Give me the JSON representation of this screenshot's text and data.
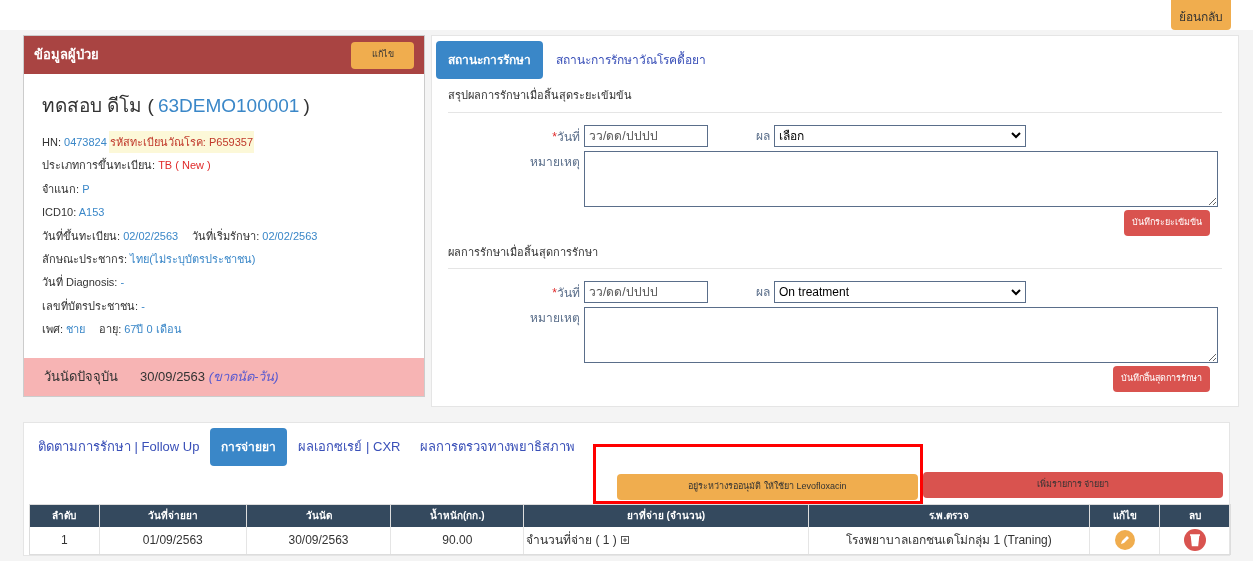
{
  "back_button": "ย้อนกลับ",
  "patient_card": {
    "title": "ข้อมูลผู้ป่วย",
    "edit_button": "แก้ไข",
    "name": "ทดสอบ ดีโม (",
    "code": "63DEMO100001",
    "name_end": ")",
    "lines": [
      [
        {
          "label": "HN:",
          "value": "0473824",
          "kind": "info"
        },
        {
          "label": "รหัสทะเบียนวัณโรค:",
          "value": "P659357",
          "kind": "highlight"
        }
      ],
      [
        {
          "label": "ประเภทการขึ้นทะเบียน:",
          "value": "TB ( New )",
          "kind": "alert"
        }
      ],
      [
        {
          "label": "จำแนก:",
          "value": "P",
          "kind": "info"
        }
      ],
      [
        {
          "label": "ICD10:",
          "value": "A153",
          "kind": "info"
        }
      ],
      [
        {
          "label": "วันที่ขึ้นทะเบียน:",
          "value": "02/02/2563",
          "kind": "info"
        },
        {
          "label": "วันที่เริ่มรักษา:",
          "value": "02/02/2563",
          "kind": "info"
        }
      ],
      [
        {
          "label": "ลักษณะประชากร:",
          "value": "ไทย(ไม่ระบุบัตรประชาชน)",
          "kind": "info"
        }
      ],
      [
        {
          "label": "วันที่ Diagnosis:",
          "value": "-",
          "kind": "info"
        }
      ],
      [
        {
          "label": "เลขที่บัตรประชาชน:",
          "value": "-",
          "kind": "info"
        }
      ],
      [
        {
          "label": "เพศ:",
          "value": "ชาย",
          "kind": "info"
        },
        {
          "label": "อายุ:",
          "value": "67ปี 0 เดือน",
          "kind": "info"
        }
      ]
    ],
    "appointment": {
      "label": "วันนัดปัจจุบัน",
      "date": "30/09/2563",
      "note": "(ขาดนัด-วัน)"
    }
  },
  "status_panel": {
    "tabs": [
      {
        "label": "สถานะการรักษา",
        "selected": true
      },
      {
        "label": "สถานะการรักษาวัณโรคดื้อยา",
        "selected": false
      }
    ],
    "sections": [
      {
        "title": "สรุปผลการรักษาเมื่อสิ้นสุดระยะเข้มข้น",
        "required_mark": "*",
        "date_label": "วันที่",
        "date_placeholder": "วว/ดด/ปปปป",
        "result_label": "ผล",
        "result_value": "เลือก",
        "note_label": "หมายเหตุ",
        "save_button": "บันทึกระยะเข้มข้น"
      },
      {
        "title": "ผลการรักษาเมื่อสิ้นสุดการรักษา",
        "required_mark": "*",
        "date_label": "วันที่",
        "date_placeholder": "วว/ดด/ปปปป",
        "result_label": "ผล",
        "result_value": "On treatment",
        "note_label": "หมายเหตุ",
        "save_button": "บันทึกสิ้นสุดการรักษา"
      }
    ]
  },
  "bottom_panel": {
    "tabs": [
      {
        "label": "ติดตามการรักษา | Follow Up",
        "selected": false
      },
      {
        "label": "การจ่ายยา",
        "selected": true
      },
      {
        "label": "ผลเอกซเรย์ | CXR",
        "selected": false
      },
      {
        "label": "ผลการตรวจทางพยาธิสภาพ",
        "selected": false
      }
    ],
    "pending_button": "อยู่ระหว่างรออนุมัติ ให้ใช้ยา Levofloxacin",
    "add_button": "เพิ่มรายการ จ่ายยา",
    "table": {
      "columns": [
        "ลำดับ",
        "วันที่จ่ายยา",
        "วันนัด",
        "น้ำหนัก(กก.)",
        "ยาที่จ่าย (จำนวน)",
        "ร.พ.ตรวจ",
        "แก้ไข",
        "ลบ"
      ],
      "rows": [
        {
          "cells": [
            "1",
            "01/09/2563",
            "30/09/2563",
            "90.00",
            "จำนวนที่จ่าย ( 1 )",
            "โรงพยาบาลเอกชนเดโม่กลุ่ม 1 (Traning)"
          ]
        }
      ]
    }
  }
}
